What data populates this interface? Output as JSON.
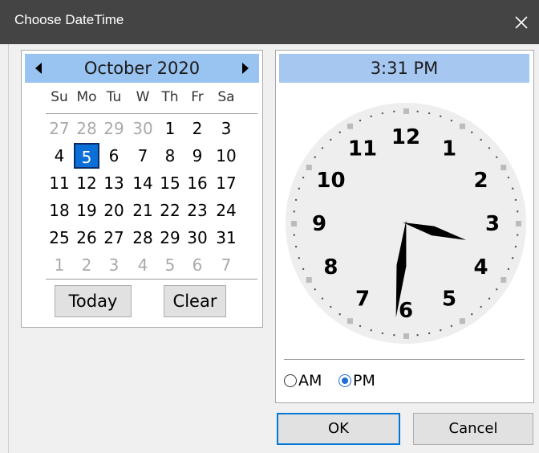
{
  "window": {
    "title": "Choose DateTime"
  },
  "calendar": {
    "month_label": "October 2020",
    "days_of_week": [
      "Su",
      "Mo",
      "Tu",
      "W",
      "Th",
      "Fr",
      "Sa"
    ],
    "weeks": [
      [
        {
          "d": "27",
          "other": true
        },
        {
          "d": "28",
          "other": true
        },
        {
          "d": "29",
          "other": true
        },
        {
          "d": "30",
          "other": true
        },
        {
          "d": "1"
        },
        {
          "d": "2"
        },
        {
          "d": "3"
        }
      ],
      [
        {
          "d": "4"
        },
        {
          "d": "5",
          "selected": true
        },
        {
          "d": "6"
        },
        {
          "d": "7"
        },
        {
          "d": "8"
        },
        {
          "d": "9"
        },
        {
          "d": "10"
        }
      ],
      [
        {
          "d": "11"
        },
        {
          "d": "12"
        },
        {
          "d": "13"
        },
        {
          "d": "14"
        },
        {
          "d": "15"
        },
        {
          "d": "16"
        },
        {
          "d": "17"
        }
      ],
      [
        {
          "d": "18"
        },
        {
          "d": "19"
        },
        {
          "d": "20"
        },
        {
          "d": "21"
        },
        {
          "d": "22"
        },
        {
          "d": "23"
        },
        {
          "d": "24"
        }
      ],
      [
        {
          "d": "25"
        },
        {
          "d": "26"
        },
        {
          "d": "27"
        },
        {
          "d": "28"
        },
        {
          "d": "29"
        },
        {
          "d": "30"
        },
        {
          "d": "31"
        }
      ],
      [
        {
          "d": "1",
          "other": true
        },
        {
          "d": "2",
          "other": true
        },
        {
          "d": "3",
          "other": true
        },
        {
          "d": "4",
          "other": true
        },
        {
          "d": "5",
          "other": true
        },
        {
          "d": "6",
          "other": true
        },
        {
          "d": "7",
          "other": true
        }
      ]
    ],
    "today_label": "Today",
    "clear_label": "Clear"
  },
  "clock": {
    "time_label": "3:31 PM",
    "hour": 3,
    "minute": 31,
    "numbers": [
      "12",
      "1",
      "2",
      "3",
      "4",
      "5",
      "6",
      "7",
      "8",
      "9",
      "10",
      "11"
    ],
    "am_label": "AM",
    "pm_label": "PM",
    "selected_period": "PM"
  },
  "buttons": {
    "ok_label": "OK",
    "cancel_label": "Cancel"
  },
  "colors": {
    "title_bar": "#444444",
    "header_blue": "#99c3f0",
    "selected_day": "#0a6fd6",
    "clock_face": "#eeeeee",
    "tick_marks": "#bbbbbb"
  }
}
